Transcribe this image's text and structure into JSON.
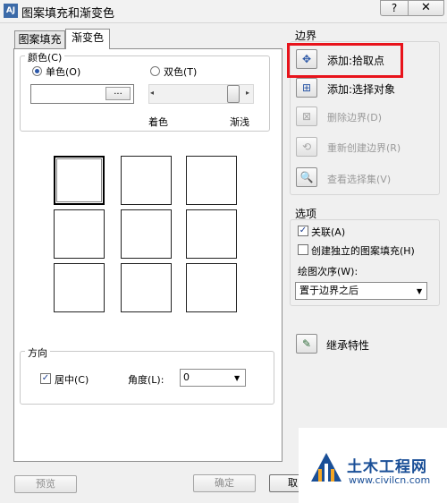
{
  "window": {
    "app_icon_text": "AJ",
    "title": "图案填充和渐变色",
    "help_label": "?",
    "close_label": "✕"
  },
  "tabs": [
    {
      "label": "图案填充",
      "active": false
    },
    {
      "label": "渐变色",
      "active": true
    }
  ],
  "color_section": {
    "label": "颜色(C)",
    "single_label": "单色(O)",
    "double_label": "双色(T)",
    "selected": "single",
    "pick_button": "...",
    "slider_left_arrow": "◂",
    "slider_right_arrow": "▸",
    "slider_value": 0.8,
    "shade_label": "着色",
    "tint_label": "渐浅"
  },
  "gradient_patterns": {
    "count": 9,
    "selected_index": 0
  },
  "orientation": {
    "label": "方向",
    "centered_label": "居中(C)",
    "centered_checked": true,
    "angle_label": "角度(L):",
    "angle_value": "0",
    "check_mark": "✓",
    "dropdown_arrow": "▼"
  },
  "boundaries": {
    "label": "边界",
    "buttons": [
      {
        "label": "添加:拾取点",
        "icon": "pick-points-icon",
        "glyph": "✥",
        "enabled": true
      },
      {
        "label": "添加:选择对象",
        "icon": "select-objects-icon",
        "glyph": "⊞",
        "enabled": true
      },
      {
        "label": "删除边界(D)",
        "icon": "remove-boundary-icon",
        "glyph": "⊠",
        "enabled": false
      },
      {
        "label": "重新创建边界(R)",
        "icon": "recreate-boundary-icon",
        "glyph": "⟲",
        "enabled": false
      },
      {
        "label": "查看选择集(V)",
        "icon": "view-selection-icon",
        "glyph": "🔍",
        "enabled": false
      }
    ]
  },
  "options": {
    "label": "选项",
    "associative_label": "关联(A)",
    "associative_checked": true,
    "separate_label": "创建独立的图案填充(H)",
    "separate_checked": false,
    "draw_order_label": "绘图次序(W):",
    "draw_order_value": "置于边界之后",
    "check_mark": "✓",
    "dropdown_arrow": "▼"
  },
  "inherit": {
    "label": "继承特性",
    "glyph": "✎"
  },
  "footer": {
    "preview_label": "预览",
    "ok_label": "确定",
    "cancel_label": "取"
  },
  "watermark": {
    "title": "土木工程网",
    "url": "www.civilcn.com"
  },
  "colors": {
    "highlight": "#e8131b",
    "accent": "#2a56a8",
    "watermark_blue": "#1a4f97"
  }
}
